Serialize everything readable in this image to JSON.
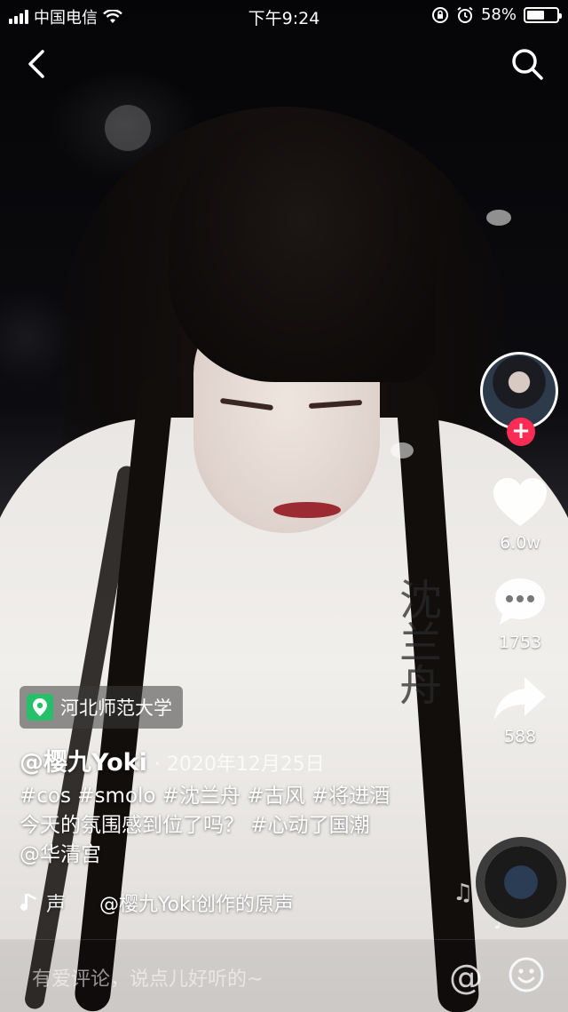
{
  "status_bar": {
    "carrier": "中国电信",
    "time": "下午9:24",
    "battery_percent": "58%",
    "battery_level": 0.58
  },
  "icons": {
    "back": "chevron-left-icon",
    "search": "search-icon",
    "like": "heart-icon",
    "comment": "comment-bubble-icon",
    "share": "share-arrow-icon",
    "music": "music-note-icon",
    "emoji": "smiley-icon"
  },
  "overlay_text": {
    "calligraphy": "沈兰舟"
  },
  "rail": {
    "follow_symbol": "+",
    "likes": "6.0w",
    "comments": "1753",
    "shares": "588"
  },
  "video_info": {
    "location": "河北师范大学",
    "author": "@樱九Yoki",
    "date": "· 2020年12月25日",
    "caption_line1": "#cos #smolo #沈兰舟 #古风 #将进酒",
    "caption_line2": "今天的氛围感到位了吗？ #心动了国潮",
    "caption_line3": "@华清宫",
    "music_scroll": "声",
    "music_title": "@樱九Yoki创作的原声"
  },
  "comment_bar": {
    "placeholder": "有爱评论，说点儿好听的~",
    "at_symbol": "@"
  },
  "colors": {
    "accent": "#fe2c55",
    "location_pin": "#27c06a"
  }
}
